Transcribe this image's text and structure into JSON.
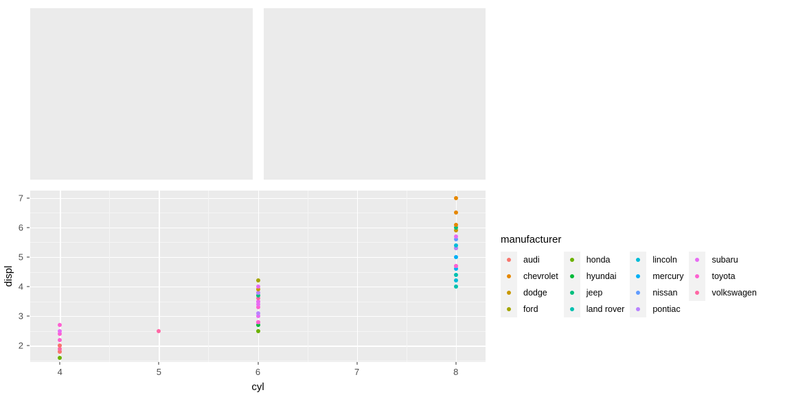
{
  "chart_data": {
    "type": "scatter",
    "title": "",
    "xlabel": "cyl",
    "ylabel": "displ",
    "xlim": [
      3.7,
      8.3
    ],
    "ylim": [
      1.45,
      7.25
    ],
    "x_ticks": [
      "4",
      "5",
      "6",
      "7",
      "8"
    ],
    "x_tick_values": [
      4,
      5,
      6,
      7,
      8
    ],
    "y_ticks": [
      "2",
      "3",
      "4",
      "5",
      "6",
      "7"
    ],
    "y_tick_values": [
      2,
      3,
      4,
      5,
      6,
      7
    ],
    "grid": "major-and-minor",
    "panel_background": "#EBEBEB",
    "gridline_major_color": "#FFFFFF",
    "gridline_minor_color": "#F5F5F5",
    "legend_position": "right",
    "color_by": "manufacturer",
    "points": [
      {
        "x": 4,
        "y": 1.6,
        "manufacturer": "honda"
      },
      {
        "x": 4,
        "y": 1.8,
        "manufacturer": "volkswagen"
      },
      {
        "x": 4,
        "y": 1.8,
        "manufacturer": "audi"
      },
      {
        "x": 4,
        "y": 1.9,
        "manufacturer": "volkswagen"
      },
      {
        "x": 4,
        "y": 2.0,
        "manufacturer": "volkswagen"
      },
      {
        "x": 4,
        "y": 2.0,
        "manufacturer": "audi"
      },
      {
        "x": 4,
        "y": 2.2,
        "manufacturer": "toyota"
      },
      {
        "x": 4,
        "y": 2.4,
        "manufacturer": "toyota"
      },
      {
        "x": 4,
        "y": 2.5,
        "manufacturer": "subaru"
      },
      {
        "x": 4,
        "y": 2.7,
        "manufacturer": "toyota"
      },
      {
        "x": 5,
        "y": 2.5,
        "manufacturer": "volkswagen"
      },
      {
        "x": 6,
        "y": 2.5,
        "manufacturer": "honda"
      },
      {
        "x": 6,
        "y": 2.7,
        "manufacturer": "hyundai"
      },
      {
        "x": 6,
        "y": 2.8,
        "manufacturer": "volkswagen"
      },
      {
        "x": 6,
        "y": 2.8,
        "manufacturer": "toyota"
      },
      {
        "x": 6,
        "y": 3.0,
        "manufacturer": "subaru"
      },
      {
        "x": 6,
        "y": 3.1,
        "manufacturer": "pontiac"
      },
      {
        "x": 6,
        "y": 3.3,
        "manufacturer": "toyota"
      },
      {
        "x": 6,
        "y": 3.4,
        "manufacturer": "subaru"
      },
      {
        "x": 6,
        "y": 3.5,
        "manufacturer": "toyota"
      },
      {
        "x": 6,
        "y": 3.5,
        "manufacturer": "subaru"
      },
      {
        "x": 6,
        "y": 3.6,
        "manufacturer": "volkswagen"
      },
      {
        "x": 6,
        "y": 3.7,
        "manufacturer": "jeep"
      },
      {
        "x": 6,
        "y": 3.8,
        "manufacturer": "toyota"
      },
      {
        "x": 6,
        "y": 3.8,
        "manufacturer": "pontiac"
      },
      {
        "x": 6,
        "y": 3.9,
        "manufacturer": "dodge"
      },
      {
        "x": 6,
        "y": 4.0,
        "manufacturer": "subaru"
      },
      {
        "x": 6,
        "y": 4.2,
        "manufacturer": "ford"
      },
      {
        "x": 8,
        "y": 4.0,
        "manufacturer": "land rover"
      },
      {
        "x": 8,
        "y": 4.2,
        "manufacturer": "lincoln"
      },
      {
        "x": 8,
        "y": 4.4,
        "manufacturer": "land rover"
      },
      {
        "x": 8,
        "y": 4.6,
        "manufacturer": "mercury"
      },
      {
        "x": 8,
        "y": 4.7,
        "manufacturer": "subaru"
      },
      {
        "x": 8,
        "y": 4.7,
        "manufacturer": "toyota"
      },
      {
        "x": 8,
        "y": 5.0,
        "manufacturer": "mercury"
      },
      {
        "x": 8,
        "y": 5.3,
        "manufacturer": "dodge"
      },
      {
        "x": 8,
        "y": 5.3,
        "manufacturer": "pontiac"
      },
      {
        "x": 8,
        "y": 5.4,
        "manufacturer": "lincoln"
      },
      {
        "x": 8,
        "y": 5.6,
        "manufacturer": "nissan"
      },
      {
        "x": 8,
        "y": 5.7,
        "manufacturer": "subaru"
      },
      {
        "x": 8,
        "y": 5.9,
        "manufacturer": "dodge"
      },
      {
        "x": 8,
        "y": 6.0,
        "manufacturer": "jeep"
      },
      {
        "x": 8,
        "y": 6.1,
        "manufacturer": "chevrolet"
      },
      {
        "x": 8,
        "y": 6.5,
        "manufacturer": "chevrolet"
      },
      {
        "x": 8,
        "y": 7.0,
        "manufacturer": "chevrolet"
      }
    ]
  },
  "legend": {
    "title": "manufacturer",
    "columns": [
      [
        {
          "label": "audi",
          "color": "#F8766D"
        },
        {
          "label": "chevrolet",
          "color": "#E58700"
        },
        {
          "label": "dodge",
          "color": "#C99800"
        },
        {
          "label": "ford",
          "color": "#A3A500"
        }
      ],
      [
        {
          "label": "honda",
          "color": "#6BB100"
        },
        {
          "label": "hyundai",
          "color": "#00BA38"
        },
        {
          "label": "jeep",
          "color": "#00BF7D"
        },
        {
          "label": "land rover",
          "color": "#00C0AF"
        }
      ],
      [
        {
          "label": "lincoln",
          "color": "#00BCD8"
        },
        {
          "label": "mercury",
          "color": "#00B0F6"
        },
        {
          "label": "nissan",
          "color": "#619CFF"
        },
        {
          "label": "pontiac",
          "color": "#B983FF"
        }
      ],
      [
        {
          "label": "subaru",
          "color": "#E76BF3"
        },
        {
          "label": "toyota",
          "color": "#FD61D1"
        },
        {
          "label": "volkswagen",
          "color": "#FF67A4"
        }
      ]
    ]
  },
  "top_panels": {
    "left": {
      "name": "empty-panel-left"
    },
    "right": {
      "name": "empty-panel-right"
    }
  }
}
